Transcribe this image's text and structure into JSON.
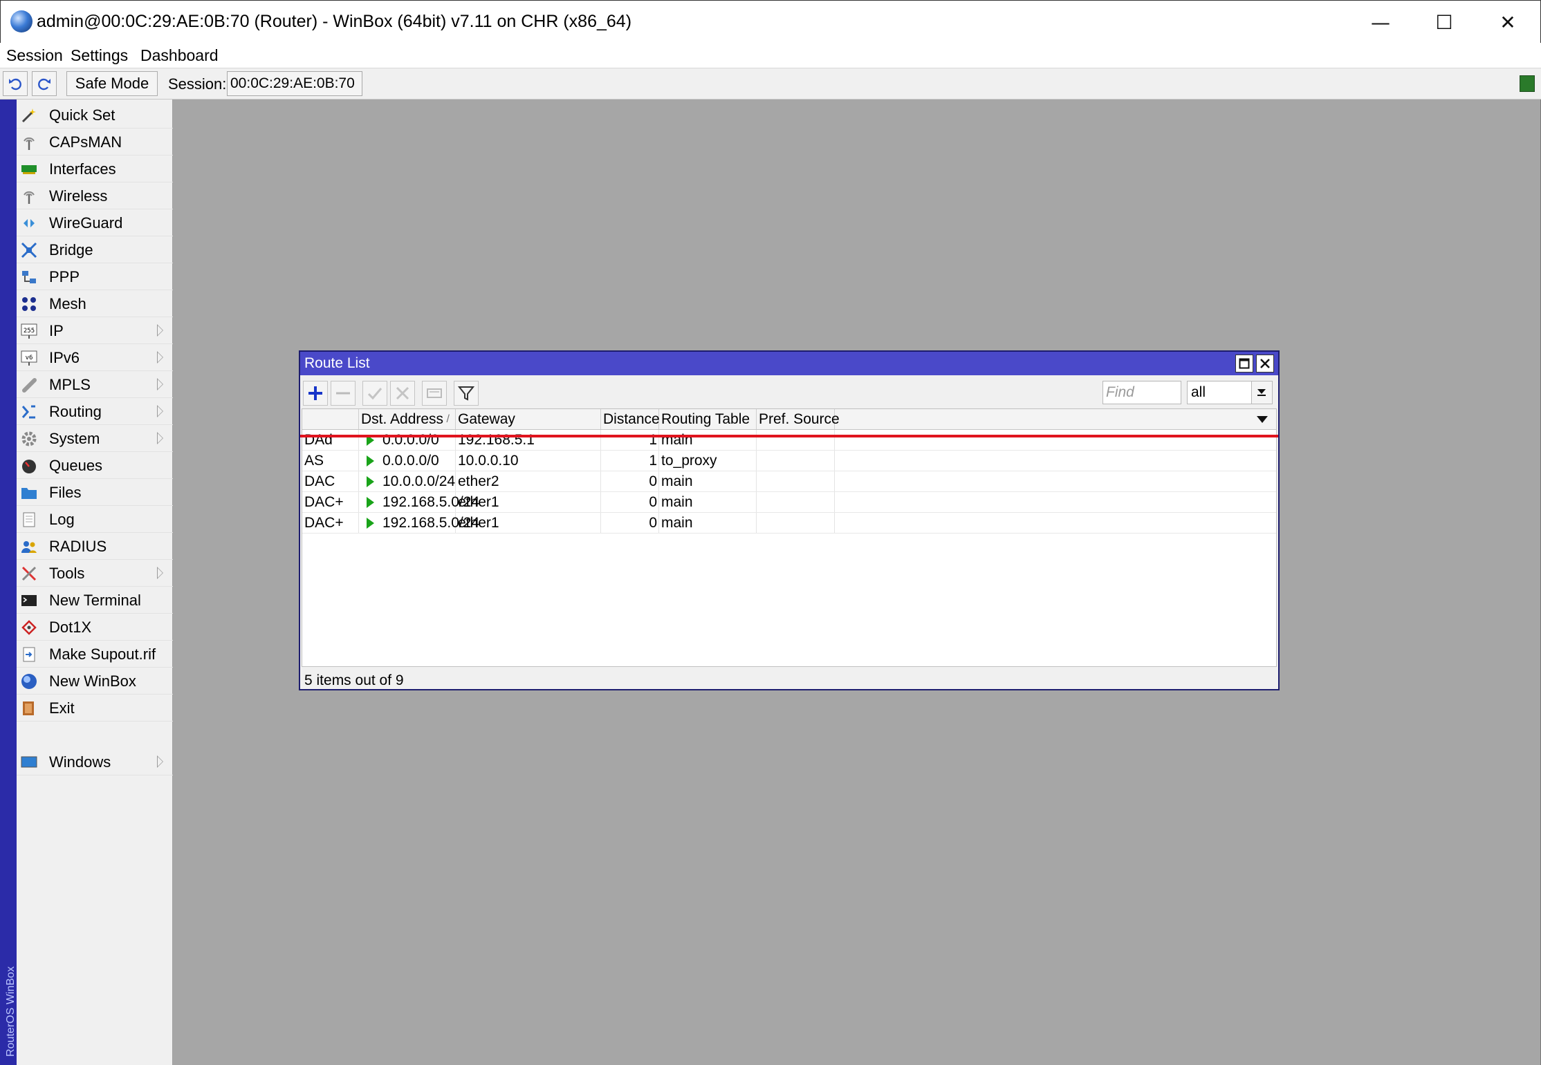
{
  "window": {
    "title": "admin@00:0C:29:AE:0B:70 (Router) - WinBox (64bit) v7.11 on CHR (x86_64)",
    "controls": {
      "minimize": "—",
      "maximize": "☐",
      "close": "✕"
    }
  },
  "menubar": {
    "items": [
      "Session",
      "Settings",
      "Dashboard"
    ]
  },
  "toolbar": {
    "safe_mode_label": "Safe Mode",
    "session_label": "Session:",
    "session_value": "00:0C:29:AE:0B:70",
    "status_color": "#2a7a2a"
  },
  "sidebar": {
    "strip_text": "RouterOS WinBox",
    "items": [
      {
        "label": "Quick Set",
        "icon": "wand-icon",
        "submenu": false
      },
      {
        "label": "CAPsMAN",
        "icon": "antenna-icon",
        "submenu": false
      },
      {
        "label": "Interfaces",
        "icon": "network-card-icon",
        "submenu": false
      },
      {
        "label": "Wireless",
        "icon": "antenna-icon",
        "submenu": false
      },
      {
        "label": "WireGuard",
        "icon": "wireguard-icon",
        "submenu": false
      },
      {
        "label": "Bridge",
        "icon": "bridge-icon",
        "submenu": false
      },
      {
        "label": "PPP",
        "icon": "ppp-icon",
        "submenu": false
      },
      {
        "label": "Mesh",
        "icon": "mesh-icon",
        "submenu": false
      },
      {
        "label": "IP",
        "icon": "ip-icon",
        "submenu": true
      },
      {
        "label": "IPv6",
        "icon": "ipv6-icon",
        "submenu": true
      },
      {
        "label": "MPLS",
        "icon": "mpls-icon",
        "submenu": true
      },
      {
        "label": "Routing",
        "icon": "routing-icon",
        "submenu": true
      },
      {
        "label": "System",
        "icon": "gear-icon",
        "submenu": true
      },
      {
        "label": "Queues",
        "icon": "gauge-icon",
        "submenu": false
      },
      {
        "label": "Files",
        "icon": "folder-icon",
        "submenu": false
      },
      {
        "label": "Log",
        "icon": "notepad-icon",
        "submenu": false
      },
      {
        "label": "RADIUS",
        "icon": "users-icon",
        "submenu": false
      },
      {
        "label": "Tools",
        "icon": "tools-icon",
        "submenu": true
      },
      {
        "label": "New Terminal",
        "icon": "terminal-icon",
        "submenu": false
      },
      {
        "label": "Dot1X",
        "icon": "dot1x-icon",
        "submenu": false
      },
      {
        "label": "Make Supout.rif",
        "icon": "supout-icon",
        "submenu": false
      },
      {
        "label": "New WinBox",
        "icon": "winbox-icon",
        "submenu": false
      },
      {
        "label": "Exit",
        "icon": "exit-icon",
        "submenu": false
      },
      {
        "label": "Windows",
        "icon": "monitor-icon",
        "submenu": true
      }
    ]
  },
  "route_list": {
    "title": "Route List",
    "find_placeholder": "Find",
    "filter_value": "all",
    "columns": [
      "Dst. Address",
      "Gateway",
      "Distance",
      "Routing Table",
      "Pref. Source"
    ],
    "sort_indicator": "/",
    "rows": [
      {
        "flags": "DAd",
        "dst": "0.0.0.0/0",
        "gateway": "192.168.5.1",
        "distance": "1",
        "table": "main",
        "pref_source": ""
      },
      {
        "flags": "AS",
        "dst": "0.0.0.0/0",
        "gateway": "10.0.0.10",
        "distance": "1",
        "table": "to_proxy",
        "pref_source": ""
      },
      {
        "flags": "DAC",
        "dst": "10.0.0.0/24",
        "gateway": "ether2",
        "distance": "0",
        "table": "main",
        "pref_source": ""
      },
      {
        "flags": "DAC+",
        "dst": "192.168.5.0/24",
        "gateway": "ether1",
        "distance": "0",
        "table": "main",
        "pref_source": ""
      },
      {
        "flags": "DAC+",
        "dst": "192.168.5.0/24",
        "gateway": "ether1",
        "distance": "0",
        "table": "main",
        "pref_source": ""
      }
    ],
    "status": "5 items out of 9"
  }
}
